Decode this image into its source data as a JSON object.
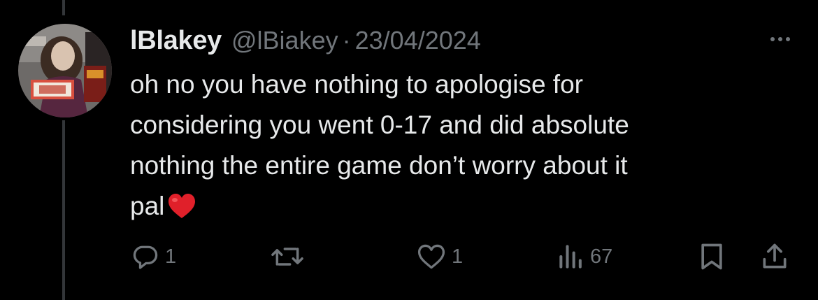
{
  "user": {
    "display_name": "lBlakey",
    "handle": "@lBiakey",
    "separator": "·",
    "date": "23/04/2024"
  },
  "tweet": {
    "text": "oh no you have nothing to apologise for\nconsidering you went 0-17 and did absolute\nnothing the entire game don’t worry about it\npal"
  },
  "actions": {
    "reply_count": "1",
    "like_count": "1",
    "views_count": "67"
  },
  "icons": {
    "avatar": "profile-photo",
    "more": "more-horizontal-icon",
    "reply": "reply-icon",
    "retweet": "retweet-icon",
    "like": "heart-outline-icon",
    "views": "analytics-icon",
    "bookmark": "bookmark-icon",
    "share": "share-icon",
    "emoji": "red-heart-emoji"
  },
  "colors": {
    "background": "#000000",
    "text_primary": "#e7e9ea",
    "text_secondary": "#71767b",
    "thread_line": "#333639",
    "heart_emoji": "#e0202a"
  }
}
